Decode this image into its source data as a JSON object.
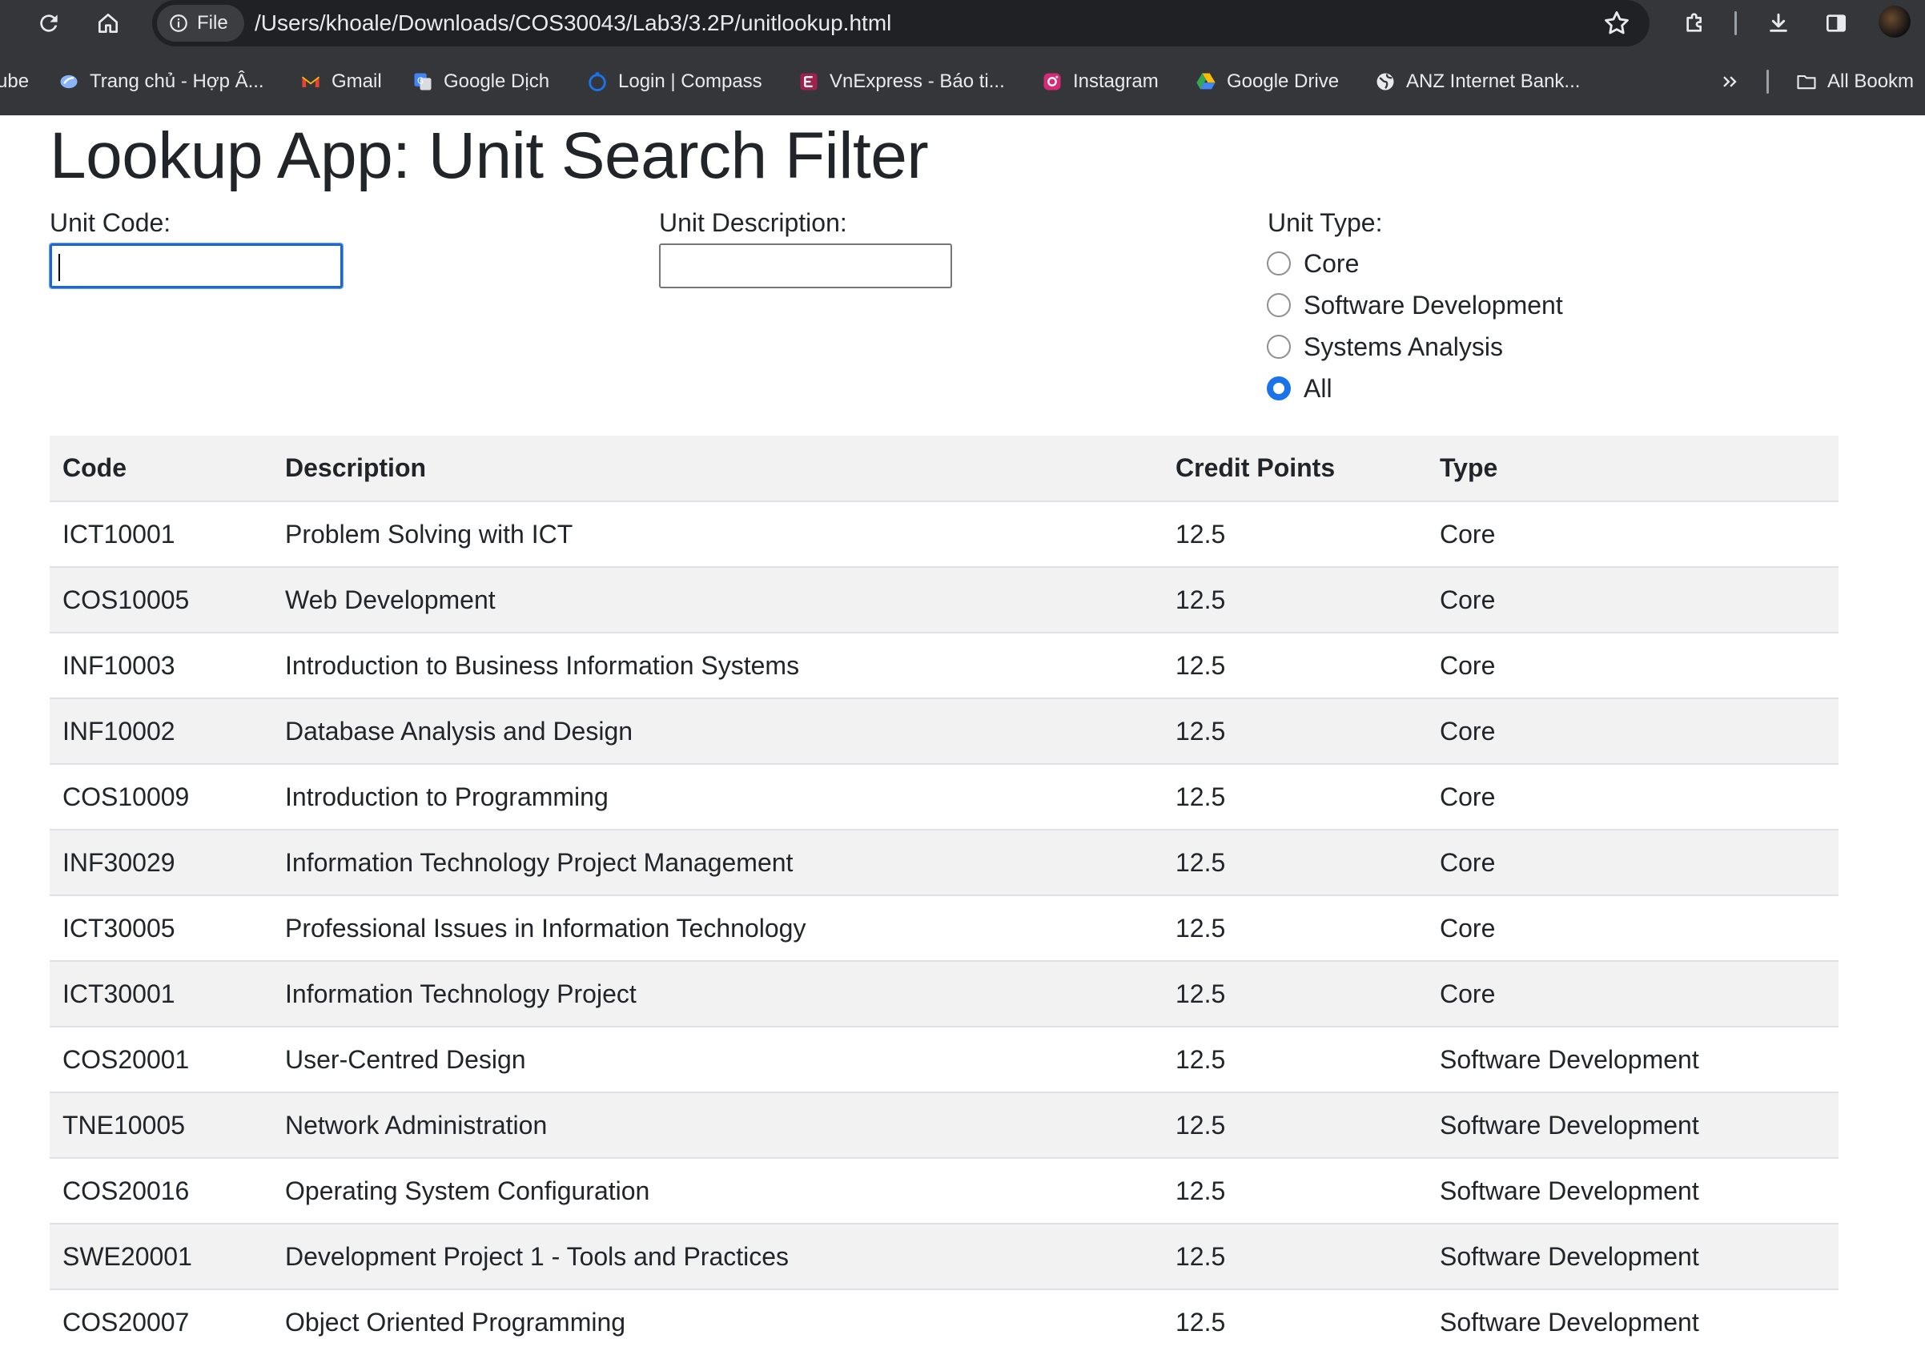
{
  "browser": {
    "address_chip": "File",
    "url": "/Users/khoale/Downloads/COS30043/Lab3/3.2P/unitlookup.html",
    "bookmarks": [
      {
        "label": "ube",
        "icon": "youtube-icon"
      },
      {
        "label": "Trang chủ - Hợp Â...",
        "icon": "site-icon"
      },
      {
        "label": "Gmail",
        "icon": "gmail-icon"
      },
      {
        "label": "Google Dịch",
        "icon": "google-translate-icon"
      },
      {
        "label": "Login | Compass",
        "icon": "compass-icon"
      },
      {
        "label": "VnExpress - Báo ti...",
        "icon": "vnexpress-icon"
      },
      {
        "label": "Instagram",
        "icon": "instagram-icon"
      },
      {
        "label": "Google Drive",
        "icon": "google-drive-icon"
      },
      {
        "label": "ANZ Internet Bank...",
        "icon": "globe-icon"
      }
    ],
    "all_bookmarks": "All Bookm"
  },
  "page": {
    "title": "Lookup App: Unit Search Filter",
    "filters": {
      "code_label": "Unit Code:",
      "code_value": "",
      "desc_label": "Unit Description:",
      "desc_value": "",
      "type_label": "Unit Type:",
      "types": [
        "Core",
        "Software Development",
        "Systems Analysis",
        "All"
      ],
      "selected_type": "All"
    },
    "table": {
      "headers": [
        "Code",
        "Description",
        "Credit Points",
        "Type"
      ],
      "rows": [
        [
          "ICT10001",
          "Problem Solving with ICT",
          "12.5",
          "Core"
        ],
        [
          "COS10005",
          "Web Development",
          "12.5",
          "Core"
        ],
        [
          "INF10003",
          "Introduction to Business Information Systems",
          "12.5",
          "Core"
        ],
        [
          "INF10002",
          "Database Analysis and Design",
          "12.5",
          "Core"
        ],
        [
          "COS10009",
          "Introduction to Programming",
          "12.5",
          "Core"
        ],
        [
          "INF30029",
          "Information Technology Project Management",
          "12.5",
          "Core"
        ],
        [
          "ICT30005",
          "Professional Issues in Information Technology",
          "12.5",
          "Core"
        ],
        [
          "ICT30001",
          "Information Technology Project",
          "12.5",
          "Core"
        ],
        [
          "COS20001",
          "User-Centred Design",
          "12.5",
          "Software Development"
        ],
        [
          "TNE10005",
          "Network Administration",
          "12.5",
          "Software Development"
        ],
        [
          "COS20016",
          "Operating System Configuration",
          "12.5",
          "Software Development"
        ],
        [
          "SWE20001",
          "Development Project 1 - Tools and Practices",
          "12.5",
          "Software Development"
        ],
        [
          "COS20007",
          "Object Oriented Programming",
          "12.5",
          "Software Development"
        ]
      ]
    }
  },
  "colors": {
    "accent": "#1a73e8",
    "chrome": "#35363a",
    "row_stripe": "#f2f2f2"
  }
}
